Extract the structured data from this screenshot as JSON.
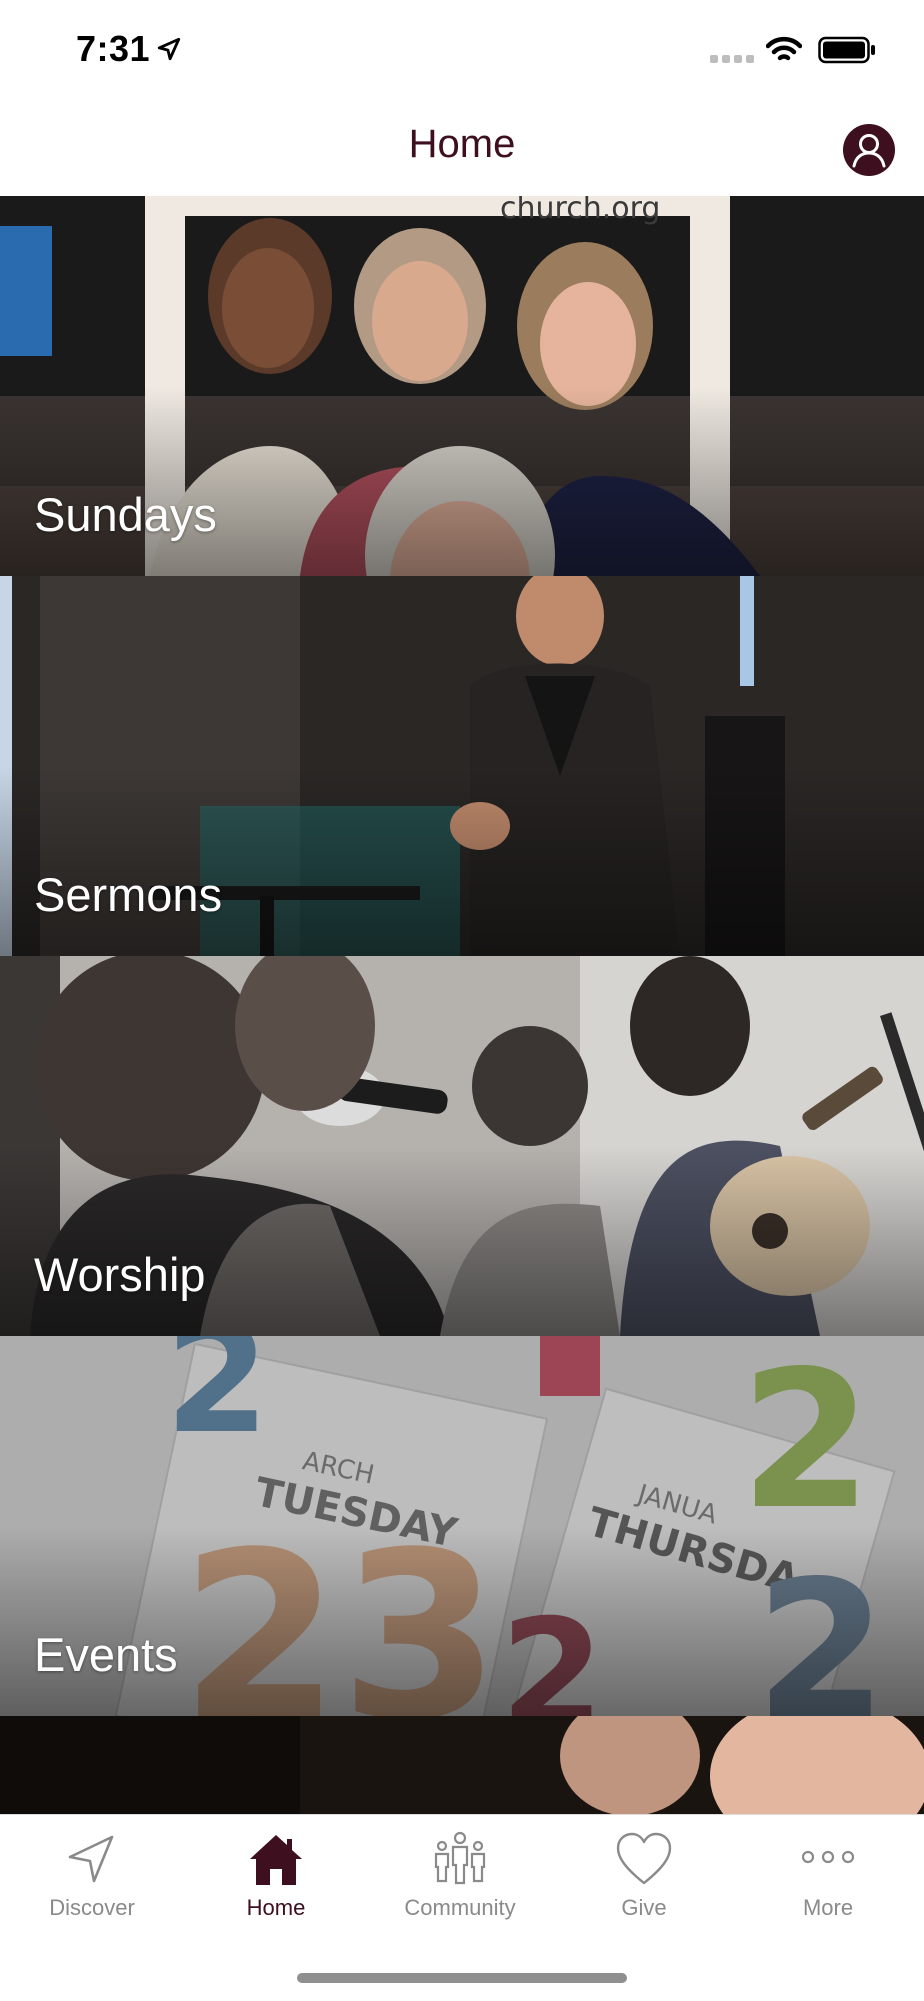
{
  "status_bar": {
    "time": "7:31"
  },
  "header": {
    "title": "Home"
  },
  "feed": {
    "tiles": [
      {
        "label": "Sundays"
      },
      {
        "label": "Sermons"
      },
      {
        "label": "Worship"
      },
      {
        "label": "Events"
      }
    ],
    "photo_snippets": {
      "sign_url": "church.org",
      "calendar_day_1": "TUESDAY",
      "calendar_month_1": "ARCH",
      "calendar_day_2": "THURSDA",
      "calendar_month_2": "JANUA"
    }
  },
  "tab_bar": {
    "items": [
      {
        "label": "Discover",
        "icon": "navigation-arrow-icon"
      },
      {
        "label": "Home",
        "icon": "home-icon"
      },
      {
        "label": "Community",
        "icon": "people-icon"
      },
      {
        "label": "Give",
        "icon": "heart-icon"
      },
      {
        "label": "More",
        "icon": "more-dots-icon"
      }
    ],
    "active": "Home"
  },
  "colors": {
    "accent": "#3d0f1f",
    "inactive": "#8a8a8a"
  }
}
